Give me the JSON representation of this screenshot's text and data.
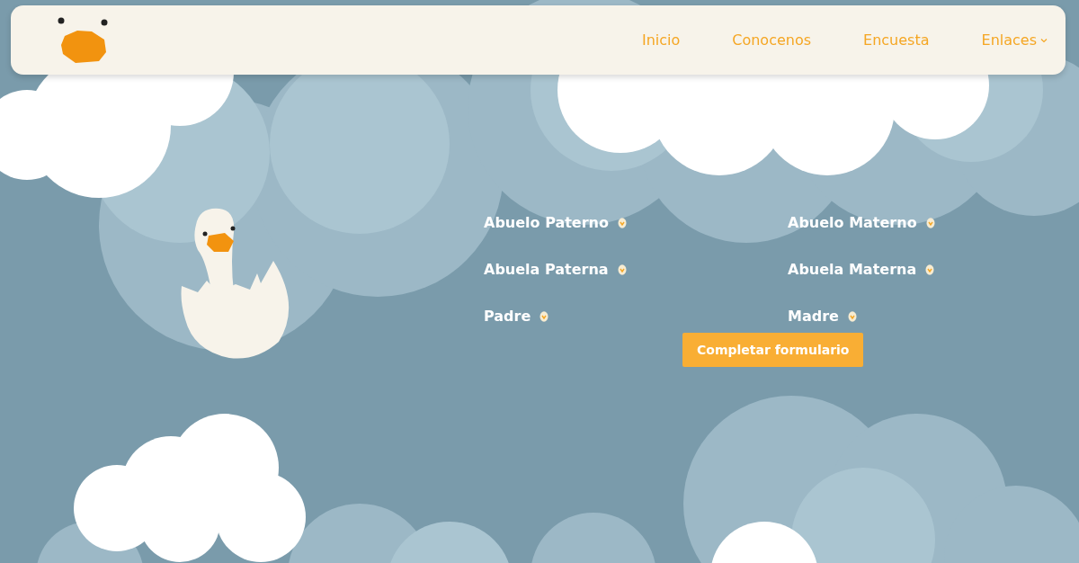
{
  "nav": {
    "items": [
      {
        "label": "Inicio",
        "dropdown": false
      },
      {
        "label": "Conocenos",
        "dropdown": false
      },
      {
        "label": "Encuesta",
        "dropdown": false
      },
      {
        "label": "Enlaces",
        "dropdown": true
      }
    ]
  },
  "family": {
    "members": [
      {
        "label": "Abuelo Paterno"
      },
      {
        "label": "Abuelo Materno"
      },
      {
        "label": "Abuela Paterna"
      },
      {
        "label": "Abuela Materna"
      },
      {
        "label": "Padre"
      },
      {
        "label": "Madre"
      }
    ],
    "button": "Completar formulario"
  }
}
